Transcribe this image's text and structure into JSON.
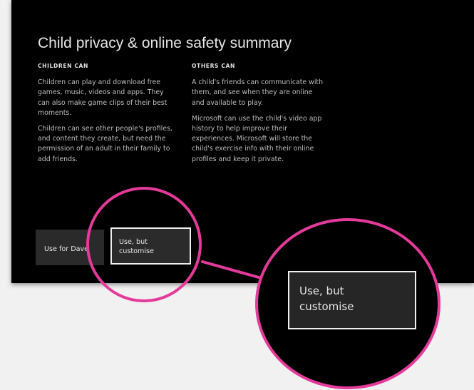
{
  "title": "Child privacy & online safety summary",
  "columns": {
    "left": {
      "heading": "CHILDREN CAN",
      "paragraphs": [
        "Children can play and download free games, music, videos and apps. They can also make game clips of their best moments.",
        "Children can see other people's profiles, and content they create, but need the permission of an adult in their family to add friends."
      ]
    },
    "right": {
      "heading": "OTHERS CAN",
      "paragraphs": [
        "A child's friends can communicate with them, and see when they are online and available to play.",
        "Microsoft can use the child's video app history to help improve their experiences. Microsoft will store the child's exercise info with their online profiles and keep it private."
      ]
    }
  },
  "buttons": {
    "use_for": "Use for Dave",
    "use_but_customise": "Use, but customise"
  },
  "colors": {
    "highlight": "#e43a9a",
    "screen_bg": "#000000",
    "button_bg": "#2a2a2a"
  }
}
